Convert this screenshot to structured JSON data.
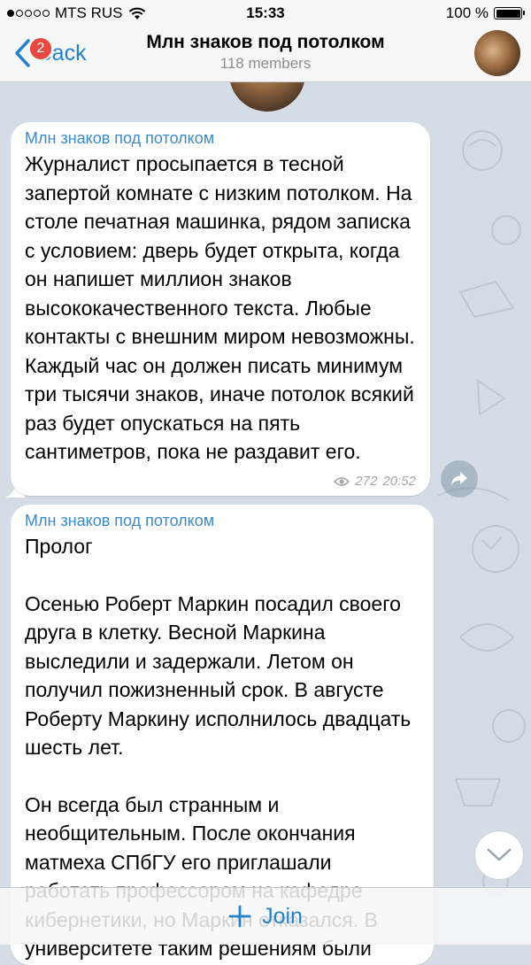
{
  "status_bar": {
    "carrier": "MTS RUS",
    "time": "15:33",
    "battery": "100 %",
    "signal_bars_filled": 1,
    "signal_bars_total": 5
  },
  "nav": {
    "back_label": "Back",
    "badge_count": "2",
    "title": "Млн знаков под потолком",
    "subtitle": "118 members"
  },
  "messages": [
    {
      "sender": "Млн знаков под потолком",
      "text": "Журналист просыпается в тесной запертой комнате с низким потолком. На столе печатная машинка, рядом записка с условием: дверь будет открыта, когда он напишет миллион знаков высококачественного текста. Любые контакты с внешним миром невозможны. Каждый час он должен писать минимум три тысячи знаков, иначе потолок всякий раз будет опускаться на пять сантиметров, пока не раздавит его.",
      "views": "272",
      "time": "20:52"
    },
    {
      "sender": "Млн знаков под потолком",
      "paragraphs": [
        "Пролог",
        "Осенью Роберт Маркин посадил своего друга в клетку. Весной Маркина выследили и задержали. Летом он получил пожизненный срок. В августе Роберту Маркину исполнилось двадцать шесть лет.",
        "Он всегда был странным и необщительным. После окончания матмеха СПбГУ его приглашали работать профессором на кафедре кибернетики, но Маркин отказался. В университете таким решениям были"
      ]
    }
  ],
  "join_bar": {
    "label": "Join"
  },
  "colors": {
    "accent": "#2481cc",
    "badge": "#e8483f",
    "sender": "#3d8ac8",
    "chat_background": "#d4dce5"
  },
  "icons": [
    "back-chevron-icon",
    "wifi-icon",
    "battery-icon",
    "eye-icon",
    "share-icon",
    "chevron-down-icon",
    "plus-icon"
  ]
}
